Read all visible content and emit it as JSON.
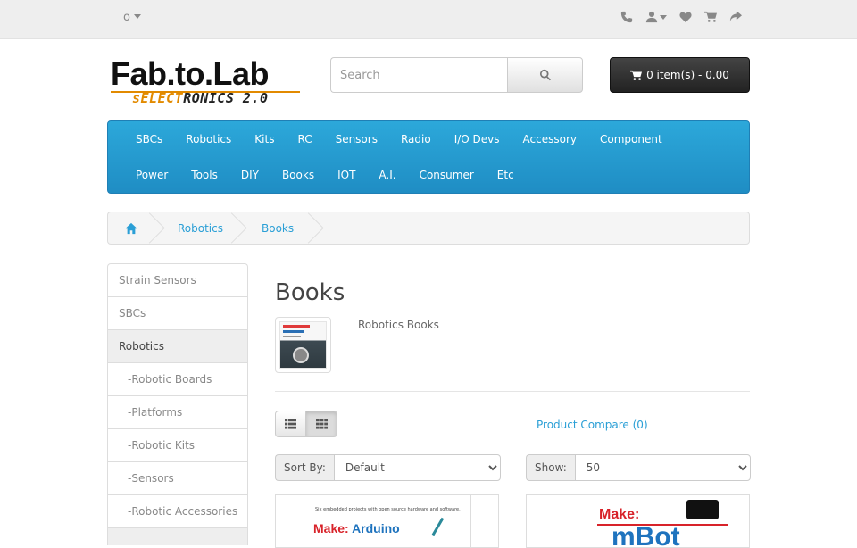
{
  "topbar": {
    "currency_label": "",
    "icons": [
      "phone-icon",
      "user-icon",
      "heart-icon",
      "shopping-cart-icon",
      "share-icon"
    ]
  },
  "logo": {
    "main": "Fab.to.Lab",
    "sub_orange": "sELECT",
    "sub_dark": "RONICS 2.0"
  },
  "search": {
    "placeholder": "Search"
  },
  "cart": {
    "label": "0 item(s) - 0.00"
  },
  "menu": {
    "row1": [
      "SBCs",
      "Robotics",
      "Kits",
      "RC",
      "Sensors",
      "Radio",
      "I/O Devs",
      "Accessory",
      "Component"
    ],
    "row2": [
      "Power",
      "Tools",
      "DIY",
      "Books",
      "IOT",
      "A.I.",
      "Consumer",
      "Etc"
    ]
  },
  "breadcrumb": {
    "items": [
      "Robotics",
      "Books"
    ]
  },
  "sidebar": {
    "items": [
      {
        "label": "Strain Sensors",
        "active": false,
        "sub": false
      },
      {
        "label": "SBCs",
        "active": false,
        "sub": false
      },
      {
        "label": "Robotics",
        "active": true,
        "sub": false
      },
      {
        "label": "-Robotic Boards",
        "active": false,
        "sub": true
      },
      {
        "label": "-Platforms",
        "active": false,
        "sub": true
      },
      {
        "label": "-Robotic Kits",
        "active": false,
        "sub": true
      },
      {
        "label": "-Sensors",
        "active": false,
        "sub": true
      },
      {
        "label": "-Robotic Accessories",
        "active": false,
        "sub": true
      }
    ]
  },
  "main": {
    "title": "Books",
    "description": "Robotics Books",
    "compare_link": "Product Compare (0)",
    "sort_label": "Sort By:",
    "sort_value": "Default",
    "show_label": "Show:",
    "show_value": "50"
  },
  "products": [
    {
      "tagline": "Six embedded projects with open source hardware and software.",
      "make": "Make:",
      "title_word": "Arduino"
    },
    {
      "make": "Make:",
      "title_word": "mBot"
    }
  ],
  "colors": {
    "menu_blue": "#2ca8da",
    "link_blue": "#2a9fd6",
    "logo_orange": "#e28a00",
    "cart_dark": "#333333"
  }
}
